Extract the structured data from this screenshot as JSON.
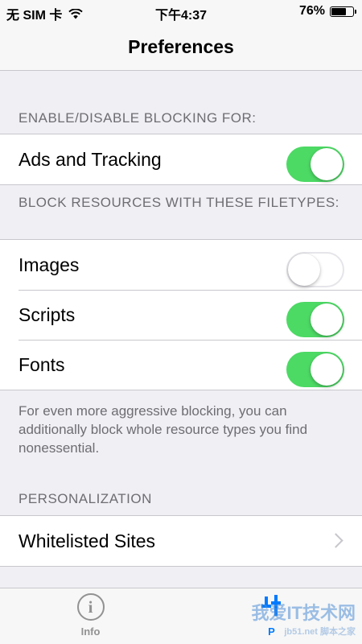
{
  "status_bar": {
    "carrier": "无 SIM 卡",
    "time": "下午4:37",
    "battery": "76%",
    "battery_level": 0.76
  },
  "nav": {
    "title": "Preferences"
  },
  "sections": {
    "blocking_header": "ENABLE/DISABLE BLOCKING FOR:",
    "ads_label": "Ads and Tracking",
    "ads_on": true,
    "filetypes_header": "BLOCK RESOURCES WITH THESE FILETYPES:",
    "images_label": "Images",
    "images_on": false,
    "scripts_label": "Scripts",
    "scripts_on": true,
    "fonts_label": "Fonts",
    "fonts_on": true,
    "filetypes_note": "For even more aggressive blocking, you can additionally block whole resource types you find nonessential.",
    "personalization_header": "PERSONALIZATION",
    "whitelisted_label": "Whitelisted Sites"
  },
  "tab_bar": {
    "info_label": "Info",
    "prefs_label": "P"
  },
  "watermark": {
    "line1": "我爱IT技术网",
    "line2": "jb51.net 脚本之家"
  },
  "colors": {
    "accent": "#007aff",
    "toggle_on": "#4cd964",
    "secondary_text": "#6d6d72"
  }
}
